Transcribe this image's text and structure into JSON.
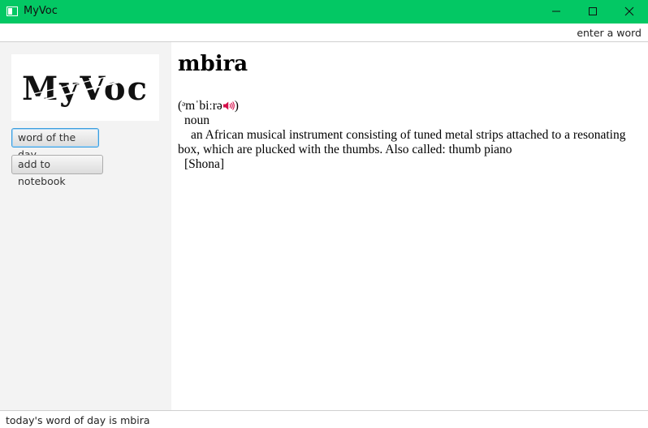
{
  "window": {
    "title": "MyVoc",
    "title_bar_color": "#03c864",
    "controls": [
      "minimize-icon",
      "maximize-icon",
      "close-icon"
    ]
  },
  "search": {
    "placeholder": "enter a word"
  },
  "sidebar": {
    "logo_text": "MyVoc",
    "buttons": {
      "word_of_day": "word of the day",
      "add_to_notebook": "add to notebook"
    }
  },
  "entry": {
    "word": "mbira",
    "pron_open": "(",
    "pronunciation": "ᵊmˈbiːrə",
    "pron_close": ")",
    "speaker_icon": "speaker-icon",
    "part_of_speech": "noun",
    "definition": "an African musical instrument consisting of tuned metal strips attached to a resonating box, which are plucked with the thumbs. Also called: thumb piano",
    "origin": "[Shona]"
  },
  "status": {
    "text": "today's word of day is mbira"
  }
}
